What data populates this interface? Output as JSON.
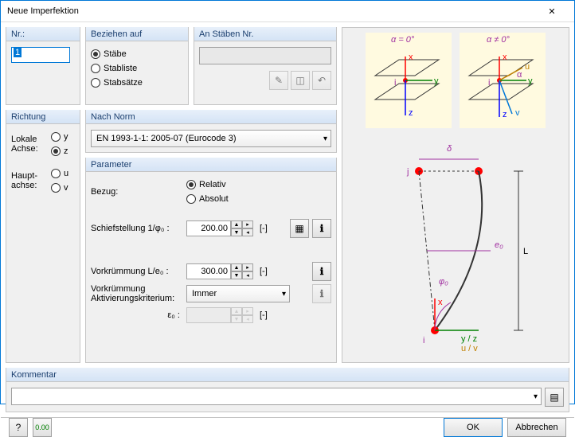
{
  "title": "Neue Imperfektion",
  "nr": {
    "legend": "Nr.:",
    "value": "1"
  },
  "richtung": {
    "legend": "Richtung",
    "lokale_label": "Lokale\nAchse:",
    "haupt_label": "Haupt-\nachse:",
    "opts": {
      "y": "y",
      "z": "z",
      "u": "u",
      "v": "v"
    },
    "selected": "z"
  },
  "beziehen": {
    "legend": "Beziehen auf",
    "opts": [
      "Stäbe",
      "Stabliste",
      "Stabsätze"
    ],
    "selected": "Stäbe"
  },
  "anstaben": {
    "legend": "An Stäben Nr.",
    "value": ""
  },
  "norm": {
    "legend": "Nach Norm",
    "selected": "EN 1993-1-1: 2005-07  (Eurocode 3)"
  },
  "parameter": {
    "legend": "Parameter",
    "bezug_label": "Bezug:",
    "bezug_opts": [
      "Relativ",
      "Absolut"
    ],
    "bezug_selected": "Relativ",
    "schief_label": "Schiefstellung 1/φ₀ :",
    "schief_value": "200.00",
    "schief_unit": "[-]",
    "vork_label": "Vorkrümmung L/e₀ :",
    "vork_value": "300.00",
    "vork_unit": "[-]",
    "aktiv_label": "Vorkrümmung\nAktivierungskriterium:",
    "aktiv_selected": "Immer",
    "eps_label": "ε₀ :",
    "eps_value": "",
    "eps_unit": "[-]"
  },
  "kommentar": {
    "legend": "Kommentar",
    "value": ""
  },
  "buttons": {
    "ok": "OK",
    "cancel": "Abbrechen"
  },
  "diagram": {
    "alpha0": "α = 0°",
    "alphaN0": "α ≠ 0°",
    "axes": [
      "x",
      "y",
      "z",
      "u",
      "v",
      "i",
      "j"
    ],
    "delta": "δ",
    "e0": "e₀",
    "phi0": "φ₀",
    "yz": "y / z",
    "uv": "u / v",
    "L": "L"
  }
}
